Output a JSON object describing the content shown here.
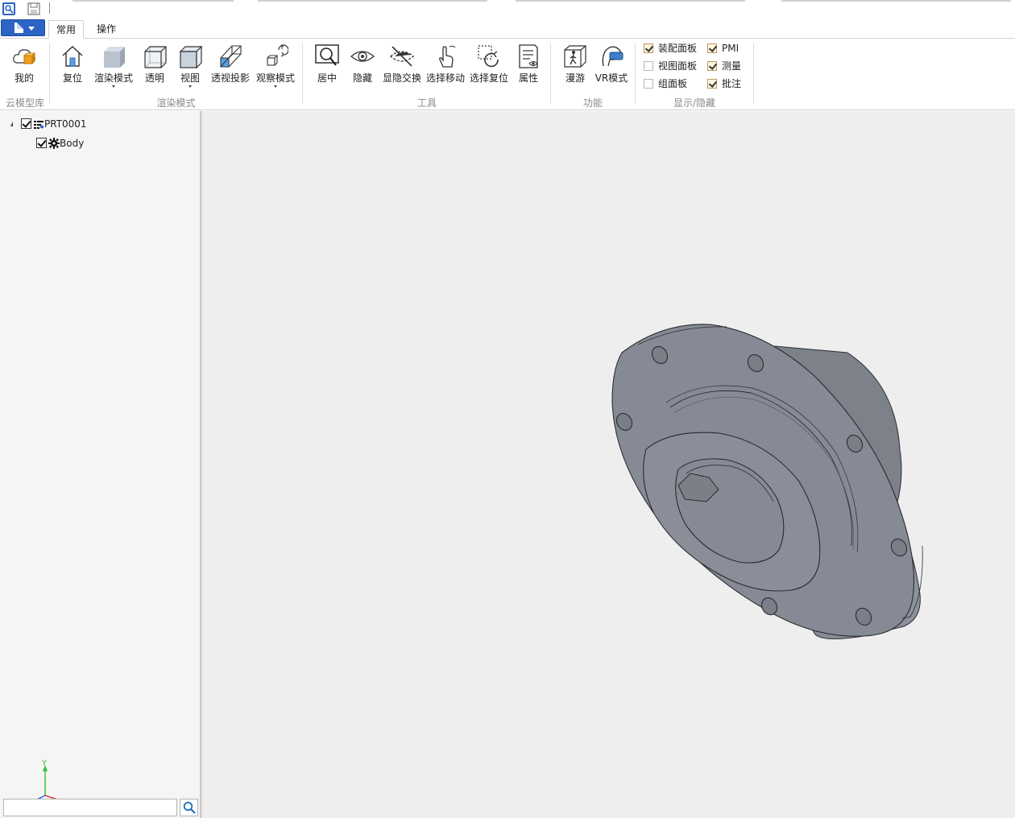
{
  "quick_access": {
    "items": [
      "app-icon",
      "save-icon"
    ]
  },
  "tabs": [
    {
      "label": "常用",
      "active": true
    },
    {
      "label": "操作",
      "active": false
    }
  ],
  "ribbon": {
    "groups": [
      {
        "label": "云模型库",
        "buttons": [
          {
            "label": "我的",
            "icon": "cloud-box-icon"
          }
        ]
      },
      {
        "label": "渲染模式",
        "buttons": [
          {
            "label": "复位",
            "icon": "home-icon"
          },
          {
            "label": "渲染模式",
            "icon": "shaded-cube-icon",
            "dropdown": true
          },
          {
            "label": "透明",
            "icon": "transparent-cube-icon"
          },
          {
            "label": "视图",
            "icon": "view-cube-icon",
            "dropdown": true
          },
          {
            "label": "透视投影",
            "icon": "perspective-icon"
          },
          {
            "label": "观察模式",
            "icon": "observe-mode-icon",
            "dropdown": true
          }
        ]
      },
      {
        "label": "工具",
        "buttons": [
          {
            "label": "居中",
            "icon": "zoom-fit-icon"
          },
          {
            "label": "隐藏",
            "icon": "eye-icon"
          },
          {
            "label": "显隐交换",
            "icon": "eye-slash-icon"
          },
          {
            "label": "选择移动",
            "icon": "hand-pointer-icon"
          },
          {
            "label": "选择复位",
            "icon": "select-reset-icon"
          },
          {
            "label": "属性",
            "icon": "properties-icon"
          }
        ]
      },
      {
        "label": "功能",
        "buttons": [
          {
            "label": "漫游",
            "icon": "walkthrough-icon"
          },
          {
            "label": "VR模式",
            "icon": "vr-headset-icon"
          }
        ]
      },
      {
        "label": "显示/隐藏",
        "checkboxes": [
          {
            "label": "装配面板",
            "checked": true
          },
          {
            "label": "视图面板",
            "checked": false
          },
          {
            "label": "组面板",
            "checked": false
          },
          {
            "label": "PMI",
            "checked": true
          },
          {
            "label": "测量",
            "checked": true
          },
          {
            "label": "批注",
            "checked": true
          }
        ]
      }
    ]
  },
  "tree": {
    "root": {
      "label": "PRT0001",
      "checked": true,
      "expanded": true
    },
    "children": [
      {
        "label": "Body",
        "checked": true
      }
    ]
  },
  "search": {
    "value": ""
  },
  "axis": {
    "y_label": "Y"
  },
  "colors": {
    "accent": "#2b64c4",
    "viewport_bg": "#eeeeee",
    "model_fill": "#868a94",
    "model_edge": "#2a2c31"
  }
}
